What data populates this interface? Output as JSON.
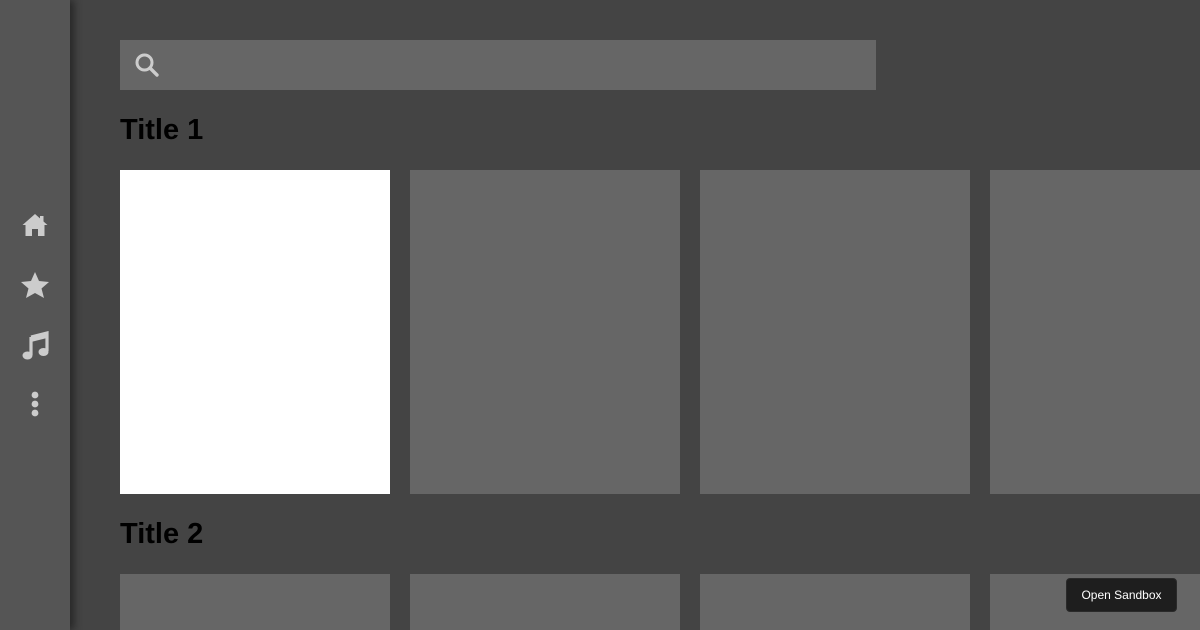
{
  "sidebar": {
    "items": [
      {
        "id": "home",
        "icon": "home-icon"
      },
      {
        "id": "favorites",
        "icon": "star-icon"
      },
      {
        "id": "music",
        "icon": "music-note-icon"
      },
      {
        "id": "more",
        "icon": "vertical-ellipsis-icon"
      }
    ],
    "icon_color": "#cccccc",
    "background": "#555555"
  },
  "search": {
    "icon": "search-icon",
    "placeholder": "",
    "value": "",
    "icon_color": "#cccccc"
  },
  "sections": [
    {
      "title": "Title 1",
      "cards": [
        {
          "selected": true
        },
        {
          "selected": false
        },
        {
          "selected": false
        },
        {
          "selected": false
        }
      ]
    },
    {
      "title": "Title 2",
      "cards": [
        {
          "selected": false
        },
        {
          "selected": false
        },
        {
          "selected": false
        },
        {
          "selected": false
        }
      ]
    }
  ],
  "sandbox_button": {
    "label": "Open Sandbox"
  },
  "colors": {
    "background": "#444444",
    "card": "#666666",
    "card_selected": "#ffffff",
    "title_text": "#000000"
  }
}
